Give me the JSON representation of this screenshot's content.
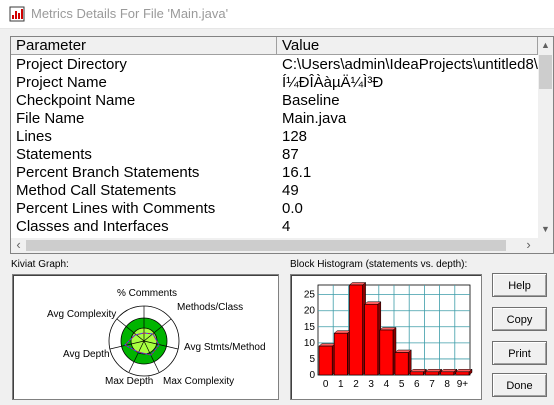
{
  "window": {
    "title": "Metrics Details For File 'Main.java'"
  },
  "table": {
    "headers": {
      "parameter": "Parameter",
      "value": "Value"
    },
    "rows": [
      {
        "parameter": "Project Directory",
        "value": "C:\\Users\\admin\\IdeaProjects\\untitled8\\"
      },
      {
        "parameter": "Project Name",
        "value": "Í¼ÐÎÀàµÄ¼Ì³Ð"
      },
      {
        "parameter": "Checkpoint Name",
        "value": "Baseline"
      },
      {
        "parameter": "File Name",
        "value": "Main.java"
      },
      {
        "parameter": "Lines",
        "value": "128"
      },
      {
        "parameter": "Statements",
        "value": "87"
      },
      {
        "parameter": "Percent Branch Statements",
        "value": "16.1"
      },
      {
        "parameter": "Method Call Statements",
        "value": "49"
      },
      {
        "parameter": "Percent Lines with Comments",
        "value": "0.0"
      },
      {
        "parameter": "Classes and Interfaces",
        "value": "4"
      }
    ]
  },
  "kiviat": {
    "label": "Kiviat Graph:",
    "axes": [
      "% Comments",
      "Methods/Class",
      "Avg Stmts/Method",
      "Max Complexity",
      "Max Depth",
      "Avg Depth",
      "Avg Complexity"
    ]
  },
  "histogram": {
    "label": "Block Histogram (statements vs. depth):"
  },
  "buttons": {
    "help": "Help",
    "copy": "Copy",
    "print": "Print",
    "done": "Done"
  },
  "chart_data": {
    "type": "bar",
    "title": "Block Histogram (statements vs. depth):",
    "categories": [
      "0",
      "1",
      "2",
      "3",
      "4",
      "5",
      "6",
      "7",
      "8",
      "9+"
    ],
    "values": [
      9,
      13,
      28,
      22,
      14,
      7,
      1,
      1,
      1,
      1
    ],
    "ylim": [
      0,
      28
    ],
    "yticks": [
      "0",
      "5",
      "10",
      "15",
      "20",
      "25"
    ],
    "grid": true,
    "bar_color": "#ff0000"
  }
}
